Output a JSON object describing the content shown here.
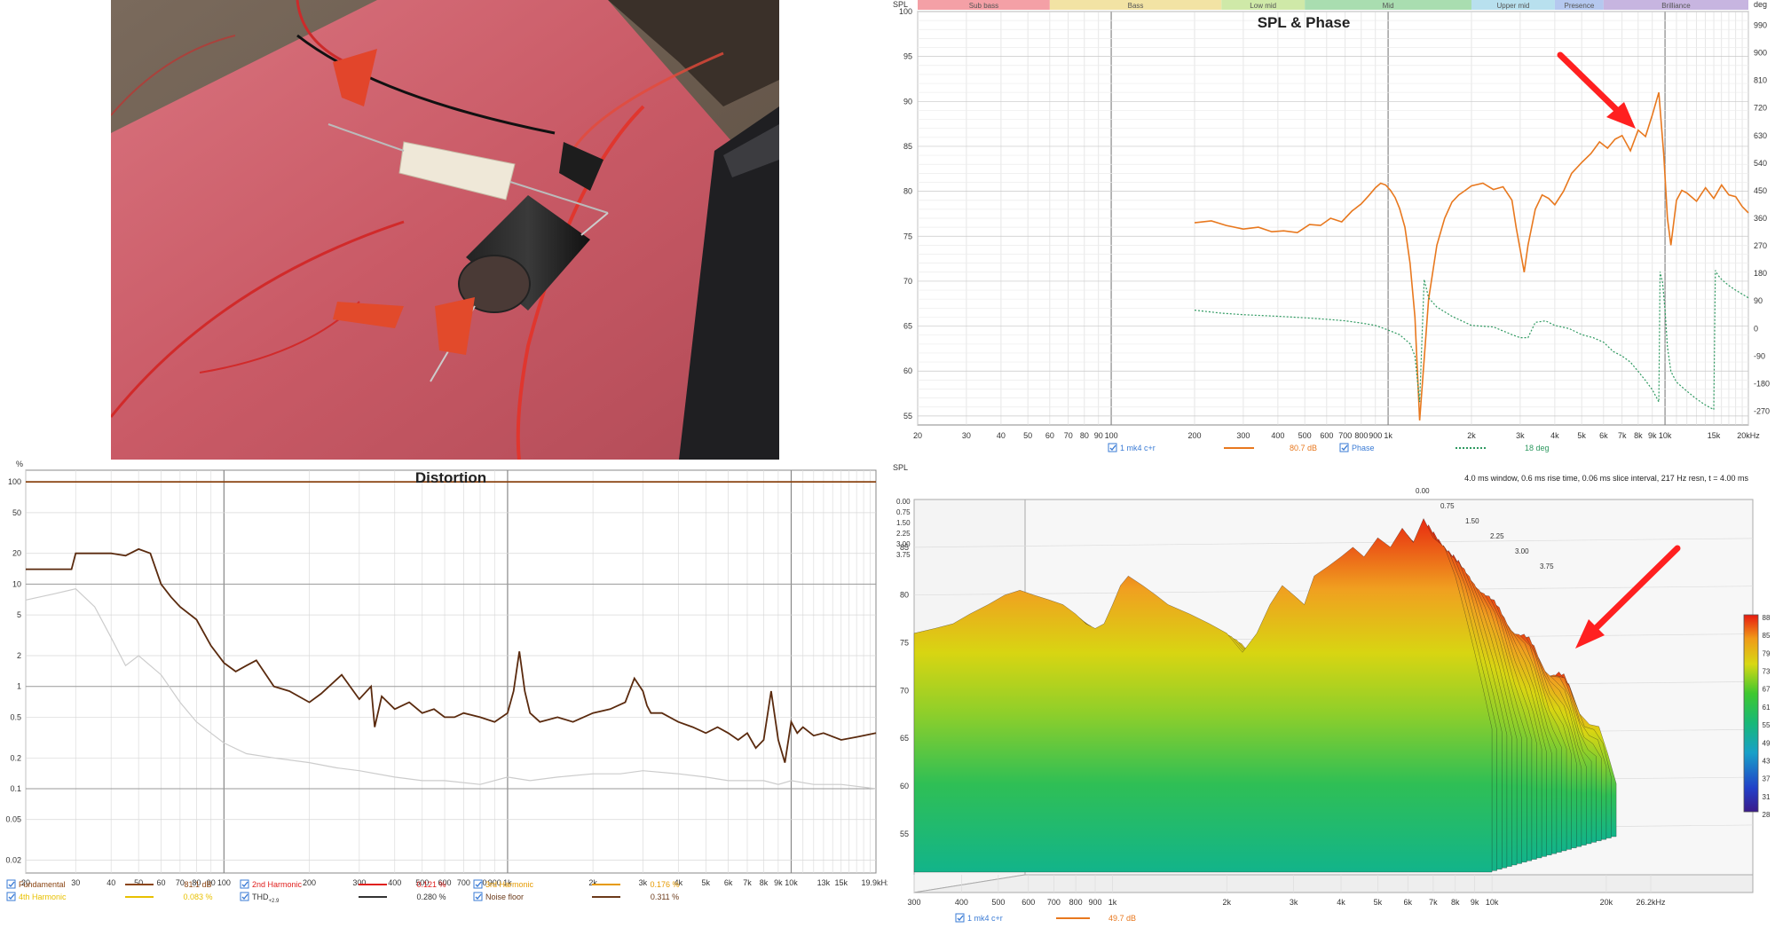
{
  "spl_panel": {
    "title": "SPL & Phase",
    "y_left_label": "SPL",
    "y_right_label": "deg",
    "bands": [
      {
        "label": "Sub bass",
        "color": "#f4a0a6",
        "from": 20,
        "to": 60
      },
      {
        "label": "Bass",
        "color": "#f2e3a4",
        "from": 60,
        "to": 250
      },
      {
        "label": "Low mid",
        "color": "#cfe9a8",
        "from": 250,
        "to": 500
      },
      {
        "label": "Mid",
        "color": "#a9ddb0",
        "from": 500,
        "to": 2000
      },
      {
        "label": "Upper mid",
        "color": "#b8e0ee",
        "from": 2000,
        "to": 4000
      },
      {
        "label": "Presence",
        "color": "#b5c8ef",
        "from": 4000,
        "to": 6000
      },
      {
        "label": "Brilliance",
        "color": "#c7b5e0",
        "from": 6000,
        "to": 20000
      }
    ],
    "legend": {
      "item1_name": "1 mk4 c+r",
      "item1_value": "80.7 dB",
      "item2_name": "Phase",
      "item2_value": "18 deg"
    }
  },
  "distortion_panel": {
    "title": "Distortion",
    "y_unit": "%",
    "legend": [
      {
        "name": "Fundamental",
        "value": "81.1 dB",
        "color": "#8b4513"
      },
      {
        "name": "2nd Harmonic",
        "value": "0.121 %",
        "color": "#e0201e"
      },
      {
        "name": "3rd Harmonic",
        "value": "0.176 %",
        "color": "#e69a00"
      },
      {
        "name": "4th Harmonic",
        "value": "0.083 %",
        "color": "#e8c000"
      },
      {
        "name": "THD",
        "sub": "+2.9",
        "value": "0.280 %",
        "color": "#333333"
      },
      {
        "name": "Noise floor",
        "value": "0.311 %",
        "color": "#6b3a1a"
      }
    ]
  },
  "waterfall_panel": {
    "y_label": "SPL",
    "info": "4.0 ms window, 0.6 ms rise time, 0.06 ms slice interval, 217 Hz resn, t = 4.00 ms",
    "time_labels": [
      "0.00",
      "0.75",
      "1.50",
      "2.25",
      "3.00",
      "3.75"
    ],
    "colorbar_ticks": [
      "88",
      "85",
      "79",
      "73",
      "67",
      "61",
      "55",
      "49",
      "43",
      "37",
      "31",
      "28"
    ],
    "legend": {
      "name": "1 mk4 c+r",
      "value": "49.7 dB"
    }
  },
  "chart_data": [
    {
      "type": "line",
      "title": "SPL & Phase",
      "xlabel": "",
      "ylabel": "SPL",
      "x_scale": "log",
      "xlim": [
        20,
        20000
      ],
      "ylim": [
        54,
        100
      ],
      "y2lim": [
        -315,
        1035
      ],
      "x_ticks": [
        {
          "v": 20,
          "l": "20"
        },
        {
          "v": 30,
          "l": "30"
        },
        {
          "v": 40,
          "l": "40"
        },
        {
          "v": 50,
          "l": "50"
        },
        {
          "v": 60,
          "l": "60"
        },
        {
          "v": 70,
          "l": "70"
        },
        {
          "v": 80,
          "l": "80"
        },
        {
          "v": 90,
          "l": "90"
        },
        {
          "v": 100,
          "l": "100"
        },
        {
          "v": 200,
          "l": "200"
        },
        {
          "v": 300,
          "l": "300"
        },
        {
          "v": 400,
          "l": "400"
        },
        {
          "v": 500,
          "l": "500"
        },
        {
          "v": 600,
          "l": "600"
        },
        {
          "v": 700,
          "l": "700"
        },
        {
          "v": 800,
          "l": "800"
        },
        {
          "v": 900,
          "l": "900"
        },
        {
          "v": 1000,
          "l": "1k"
        },
        {
          "v": 2000,
          "l": "2k"
        },
        {
          "v": 3000,
          "l": "3k"
        },
        {
          "v": 4000,
          "l": "4k"
        },
        {
          "v": 5000,
          "l": "5k"
        },
        {
          "v": 6000,
          "l": "6k"
        },
        {
          "v": 7000,
          "l": "7k"
        },
        {
          "v": 8000,
          "l": "8k"
        },
        {
          "v": 9000,
          "l": "9k"
        },
        {
          "v": 10000,
          "l": "10k"
        },
        {
          "v": 15000,
          "l": "15k"
        },
        {
          "v": 20000,
          "l": "20kHz"
        }
      ],
      "y_ticks": [
        55,
        60,
        65,
        70,
        75,
        80,
        85,
        90,
        95,
        100
      ],
      "y2_ticks": [
        -270,
        -180,
        -90,
        0,
        90,
        180,
        270,
        360,
        450,
        540,
        630,
        720,
        810,
        900,
        990
      ],
      "series": [
        {
          "name": "1 mk4 c+r",
          "color": "#e8781e",
          "axis": "left",
          "x": [
            200,
            230,
            260,
            300,
            340,
            380,
            420,
            470,
            520,
            570,
            620,
            680,
            740,
            800,
            850,
            900,
            940,
            980,
            1020,
            1060,
            1100,
            1150,
            1200,
            1250,
            1300,
            1400,
            1500,
            1600,
            1700,
            1800,
            1900,
            2000,
            2200,
            2400,
            2600,
            2800,
            2900,
            3000,
            3100,
            3200,
            3400,
            3600,
            3800,
            4000,
            4300,
            4600,
            5000,
            5400,
            5800,
            6200,
            6600,
            7000,
            7500,
            8000,
            8500,
            9000,
            9500,
            9900,
            10200,
            10500,
            11000,
            11500,
            12000,
            13000,
            14000,
            15000,
            16000,
            17000,
            18000,
            19000,
            20000
          ],
          "y": [
            76.5,
            76.7,
            76.2,
            75.8,
            76.0,
            75.5,
            75.6,
            75.4,
            76.3,
            76.2,
            77.0,
            76.6,
            77.8,
            78.6,
            79.5,
            80.4,
            80.9,
            80.7,
            80.1,
            79.3,
            78.1,
            76.0,
            72.0,
            66.0,
            54.5,
            68.0,
            74.0,
            77.0,
            78.8,
            79.6,
            80.1,
            80.6,
            80.9,
            80.2,
            80.5,
            79.0,
            76.0,
            73.5,
            71.0,
            74.0,
            78.0,
            79.6,
            79.2,
            78.5,
            80.0,
            82.0,
            83.2,
            84.2,
            85.5,
            84.8,
            85.8,
            86.2,
            84.5,
            86.8,
            86.1,
            88.5,
            91.0,
            84.0,
            77.0,
            74.0,
            79.0,
            80.1,
            79.8,
            78.9,
            80.4,
            79.2,
            80.7,
            79.6,
            79.4,
            78.3,
            77.6
          ]
        },
        {
          "name": "Phase",
          "color": "#2e9960",
          "axis": "right",
          "x": [
            200,
            250,
            300,
            400,
            500,
            600,
            700,
            800,
            900,
            1000,
            1100,
            1200,
            1250,
            1300,
            1350,
            1400,
            1500,
            1700,
            2000,
            2400,
            2800,
            3000,
            3200,
            3400,
            3700,
            4000,
            4500,
            5000,
            5500,
            6000,
            6500,
            7000,
            7500,
            8000,
            8500,
            9000,
            9500,
            9600,
            9800,
            10000,
            10200,
            10500,
            11000,
            12000,
            13000,
            14000,
            15000,
            15200,
            15500,
            16000,
            17000,
            18000,
            20000
          ],
          "y": [
            60,
            50,
            45,
            40,
            35,
            30,
            25,
            18,
            10,
            -5,
            -20,
            -50,
            -90,
            -240,
            160,
            100,
            70,
            40,
            10,
            5,
            -20,
            -30,
            -30,
            20,
            25,
            10,
            0,
            -20,
            -30,
            -45,
            -75,
            -90,
            -110,
            -140,
            -170,
            -200,
            -240,
            185,
            150,
            60,
            -60,
            -140,
            -175,
            -205,
            -230,
            -250,
            -265,
            190,
            175,
            160,
            140,
            125,
            100
          ]
        }
      ]
    },
    {
      "type": "line",
      "title": "Distortion",
      "xlabel": "",
      "ylabel": "%",
      "x_scale": "log",
      "y_scale": "log",
      "xlim": [
        20,
        19900
      ],
      "ylim": [
        0.015,
        130
      ],
      "x_ticks": [
        {
          "v": 20,
          "l": "20"
        },
        {
          "v": 30,
          "l": "30"
        },
        {
          "v": 40,
          "l": "40"
        },
        {
          "v": 50,
          "l": "50"
        },
        {
          "v": 60,
          "l": "60"
        },
        {
          "v": 70,
          "l": "70"
        },
        {
          "v": 80,
          "l": "80"
        },
        {
          "v": 90,
          "l": "90"
        },
        {
          "v": 100,
          "l": "100"
        },
        {
          "v": 200,
          "l": "200"
        },
        {
          "v": 300,
          "l": "300"
        },
        {
          "v": 400,
          "l": "400"
        },
        {
          "v": 500,
          "l": "500"
        },
        {
          "v": 600,
          "l": "600"
        },
        {
          "v": 700,
          "l": "700"
        },
        {
          "v": 800,
          "l": "800"
        },
        {
          "v": 900,
          "l": "900"
        },
        {
          "v": 1000,
          "l": "1k"
        },
        {
          "v": 2000,
          "l": "2k"
        },
        {
          "v": 3000,
          "l": "3k"
        },
        {
          "v": 4000,
          "l": "4k"
        },
        {
          "v": 5000,
          "l": "5k"
        },
        {
          "v": 6000,
          "l": "6k"
        },
        {
          "v": 7000,
          "l": "7k"
        },
        {
          "v": 8000,
          "l": "8k"
        },
        {
          "v": 9000,
          "l": "9k"
        },
        {
          "v": 10000,
          "l": "10k"
        },
        {
          "v": 13000,
          "l": "13k"
        },
        {
          "v": 15000,
          "l": "15k"
        },
        {
          "v": 19900,
          "l": "19.9kHz"
        }
      ],
      "y_ticks": [
        {
          "v": 100,
          "l": "100"
        },
        {
          "v": 50,
          "l": "50"
        },
        {
          "v": 20,
          "l": "20"
        },
        {
          "v": 10,
          "l": "10"
        },
        {
          "v": 5,
          "l": "5"
        },
        {
          "v": 2,
          "l": "2"
        },
        {
          "v": 1,
          "l": "1"
        },
        {
          "v": 0.5,
          "l": "0.5"
        },
        {
          "v": 0.2,
          "l": "0.2"
        },
        {
          "v": 0.1,
          "l": "0.1"
        },
        {
          "v": 0.05,
          "l": "0.05"
        },
        {
          "v": 0.02,
          "l": "0.02"
        }
      ],
      "series": [
        {
          "name": "Fundamental",
          "color": "#8b4513",
          "x": [
            20,
            19900
          ],
          "y": [
            100,
            100
          ]
        },
        {
          "name": "THD",
          "color": "#5a2a0e",
          "x": [
            20,
            29,
            30,
            40,
            45,
            50,
            55,
            60,
            65,
            70,
            80,
            90,
            100,
            110,
            120,
            130,
            150,
            170,
            200,
            220,
            260,
            300,
            330,
            340,
            360,
            400,
            450,
            500,
            550,
            600,
            650,
            700,
            800,
            900,
            1000,
            1050,
            1100,
            1150,
            1200,
            1300,
            1500,
            1700,
            2000,
            2300,
            2600,
            2800,
            3000,
            3100,
            3200,
            3500,
            4000,
            4500,
            5000,
            5500,
            6000,
            6500,
            7000,
            7500,
            8000,
            8500,
            9000,
            9500,
            10000,
            10500,
            11000,
            12000,
            13000,
            15000,
            17000,
            19900
          ],
          "y": [
            14,
            14,
            20,
            20,
            19,
            22,
            20,
            10,
            7.5,
            6,
            4.5,
            2.5,
            1.7,
            1.4,
            1.6,
            1.8,
            1.0,
            0.9,
            0.7,
            0.85,
            1.3,
            0.75,
            1.0,
            0.4,
            0.8,
            0.6,
            0.7,
            0.55,
            0.6,
            0.5,
            0.5,
            0.55,
            0.5,
            0.45,
            0.55,
            0.9,
            2.2,
            0.9,
            0.55,
            0.45,
            0.5,
            0.45,
            0.55,
            0.6,
            0.7,
            1.2,
            0.9,
            0.65,
            0.55,
            0.55,
            0.45,
            0.4,
            0.35,
            0.4,
            0.35,
            0.3,
            0.35,
            0.25,
            0.3,
            0.9,
            0.3,
            0.18,
            0.45,
            0.35,
            0.4,
            0.33,
            0.35,
            0.3,
            0.32,
            0.35
          ]
        },
        {
          "name": "Noise floor",
          "color": "#cccccc",
          "x": [
            20,
            25,
            30,
            35,
            40,
            45,
            50,
            60,
            70,
            80,
            90,
            100,
            120,
            150,
            200,
            250,
            300,
            400,
            500,
            600,
            800,
            1000,
            1200,
            1500,
            2000,
            2500,
            3000,
            4000,
            5000,
            6000,
            7000,
            8000,
            9000,
            10000,
            12000,
            15000,
            19900
          ],
          "y": [
            7,
            8,
            9,
            6,
            3,
            1.6,
            2.0,
            1.3,
            0.7,
            0.45,
            0.35,
            0.28,
            0.22,
            0.2,
            0.18,
            0.16,
            0.15,
            0.13,
            0.12,
            0.12,
            0.11,
            0.13,
            0.12,
            0.13,
            0.14,
            0.14,
            0.15,
            0.14,
            0.13,
            0.12,
            0.12,
            0.12,
            0.11,
            0.12,
            0.11,
            0.11,
            0.1
          ]
        }
      ]
    },
    {
      "type": "area",
      "title": "",
      "xlabel": "",
      "ylabel": "SPL",
      "x_scale": "log",
      "xlim": [
        300,
        26200
      ],
      "ylim": [
        51,
        90
      ],
      "x_ticks": [
        {
          "v": 300,
          "l": "300"
        },
        {
          "v": 400,
          "l": "400"
        },
        {
          "v": 500,
          "l": "500"
        },
        {
          "v": 600,
          "l": "600"
        },
        {
          "v": 700,
          "l": "700"
        },
        {
          "v": 800,
          "l": "800"
        },
        {
          "v": 900,
          "l": "900"
        },
        {
          "v": 1000,
          "l": "1k"
        },
        {
          "v": 2000,
          "l": "2k"
        },
        {
          "v": 3000,
          "l": "3k"
        },
        {
          "v": 4000,
          "l": "4k"
        },
        {
          "v": 5000,
          "l": "5k"
        },
        {
          "v": 6000,
          "l": "6k"
        },
        {
          "v": 7000,
          "l": "7k"
        },
        {
          "v": 8000,
          "l": "8k"
        },
        {
          "v": 9000,
          "l": "9k"
        },
        {
          "v": 10000,
          "l": "10k"
        },
        {
          "v": 20000,
          "l": "20k"
        },
        {
          "v": 26200,
          "l": "26.2kHz"
        }
      ],
      "y_ticks": [
        55,
        60,
        65,
        70,
        75,
        80,
        85
      ],
      "series": [
        {
          "name": "1 mk4 c+r",
          "color": "#e8781e",
          "x": [
            300,
            340,
            380,
            420,
            470,
            520,
            570,
            620,
            680,
            740,
            800,
            850,
            900,
            950,
            1000,
            1050,
            1100,
            1200,
            1300,
            1400,
            1600,
            1800,
            2000,
            2200,
            2400,
            2600,
            2800,
            3000,
            3200,
            3400,
            3700,
            4000,
            4300,
            4600,
            5000,
            5400,
            5800,
            6200,
            6600,
            7000,
            7500,
            8000,
            8500,
            9000,
            9500,
            10000
          ],
          "y": [
            76,
            76.5,
            77,
            78,
            79,
            80,
            80.5,
            80,
            79.5,
            79,
            78,
            77,
            76.5,
            77,
            79,
            81,
            82,
            81,
            80,
            79,
            78,
            77,
            76,
            74,
            76,
            79,
            81,
            80,
            79,
            82,
            83,
            84,
            85,
            84,
            86,
            85,
            87,
            85.5,
            88,
            86,
            85,
            82,
            78,
            74,
            70,
            66
          ]
        }
      ]
    }
  ]
}
